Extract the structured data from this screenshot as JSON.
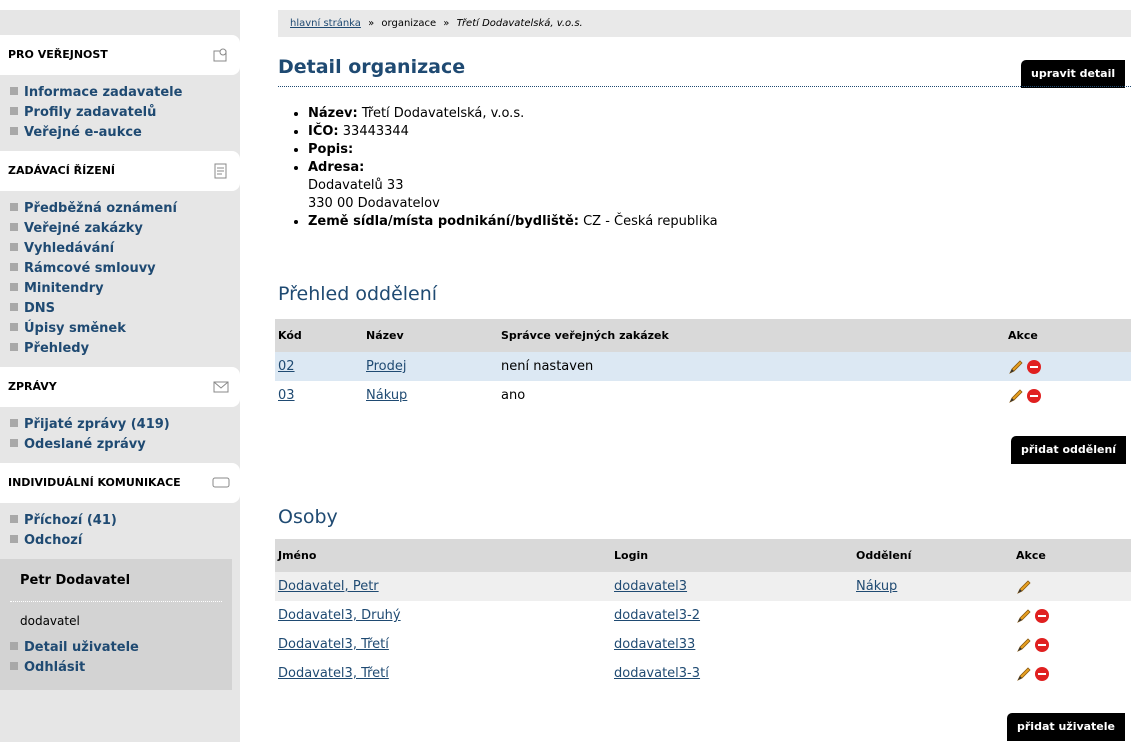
{
  "sidebar": {
    "sections": [
      {
        "title": "PRO VEŘEJNOST",
        "icon": "person-icon",
        "items": [
          "Informace zadavatele",
          "Profily zadavatelů",
          "Veřejné e-aukce"
        ]
      },
      {
        "title": "ZADÁVACÍ ŘÍZENÍ",
        "icon": "document-icon",
        "items": [
          "Předběžná oznámení",
          "Veřejné zakázky",
          "Vyhledávání",
          "Rámcové smlouvy",
          "Minitendry",
          "DNS",
          "Úpisy směnek",
          "Přehledy"
        ]
      },
      {
        "title": "ZPRÁVY",
        "icon": "envelope-icon",
        "items": [
          "Přijaté zprávy (419)",
          "Odeslané zprávy"
        ]
      },
      {
        "title": "INDIVIDUÁLNÍ KOMUNIKACE",
        "icon": "chat-icon",
        "items": [
          "Příchozí (41)",
          "Odchozí"
        ]
      }
    ],
    "user": {
      "name": "Petr Dodavatel",
      "role": "dodavatel",
      "links": [
        "Detail uživatele",
        "Odhlásit"
      ]
    }
  },
  "breadcrumb": {
    "home": "hlavní stránka",
    "sep": "»",
    "middle": "organizace",
    "current": "Třetí Dodavatelská, v.o.s."
  },
  "page": {
    "title": "Detail organizace",
    "edit_button": "upravit detail"
  },
  "detail": {
    "name_label": "Název:",
    "name_value": "Třetí Dodavatelská, v.o.s.",
    "ico_label": "IČO:",
    "ico_value": "33443344",
    "popis_label": "Popis:",
    "address_label": "Adresa:",
    "address_line1": "Dodavatelů 33",
    "address_line2": "330 00 Dodavatelov",
    "country_label": "Země sídla/místa podnikání/bydliště:",
    "country_value": "CZ - Česká republika"
  },
  "departments": {
    "heading": "Přehled oddělení",
    "columns": [
      "Kód",
      "Název",
      "Správce veřejných zakázek",
      "Akce"
    ],
    "rows": [
      {
        "code": "02",
        "name": "Prodej",
        "manager": "není nastaven"
      },
      {
        "code": "03",
        "name": "Nákup",
        "manager": "ano"
      }
    ],
    "add_button": "přidat oddělení"
  },
  "persons": {
    "heading": "Osoby",
    "columns": [
      "Jméno",
      "Login",
      "Oddělení",
      "Akce"
    ],
    "rows": [
      {
        "name": "Dodavatel, Petr",
        "login": "dodavatel3",
        "dept": "Nákup"
      },
      {
        "name": "Dodavatel3, Druhý",
        "login": "dodavatel3-2",
        "dept": ""
      },
      {
        "name": "Dodavatel3, Třetí",
        "login": "dodavatel33",
        "dept": ""
      },
      {
        "name": "Dodavatel3, Třetí",
        "login": "dodavatel3-3",
        "dept": ""
      }
    ],
    "add_button": "přidat uživatele"
  },
  "colors": {
    "link": "#1f4a72",
    "header_bg": "#d9d9d9",
    "highlight_row": "#dce8f3",
    "sidebar_bg": "#e6e6e6"
  }
}
